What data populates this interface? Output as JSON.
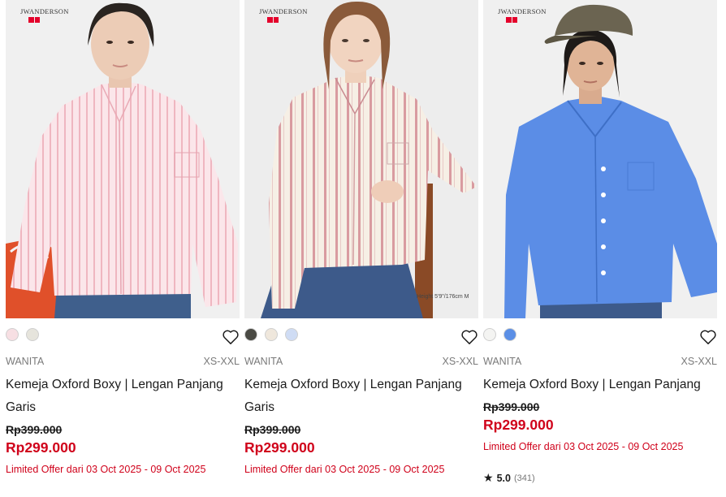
{
  "products": [
    {
      "brand": "JWANDERSON",
      "swatches": [
        "#f7dfe3",
        "#e6e4dc"
      ],
      "gender": "WANITA",
      "sizes": "XS-XXL",
      "name": "Kemeja Oxford Boxy | Lengan Panjang Garis",
      "old_price": "Rp399.000",
      "price": "Rp299.000",
      "offer": "Limited Offer dari 03 Oct 2025 - 09 Oct 2025",
      "heart_icon": "heart-outline-icon"
    },
    {
      "brand": "JWANDERSON",
      "model_info": "Height 5'9\"/176cm M",
      "swatches": [
        "#4a4a44",
        "#efe7dc",
        "#cfdcf4"
      ],
      "gender": "WANITA",
      "sizes": "XS-XXL",
      "name": "Kemeja Oxford Boxy | Lengan Panjang Garis",
      "old_price": "Rp399.000",
      "price": "Rp299.000",
      "offer": "Limited Offer dari 03 Oct 2025 - 09 Oct 2025",
      "heart_icon": "heart-outline-icon"
    },
    {
      "brand": "JWANDERSON",
      "swatches": [
        "#f4f4f2",
        "#5b8fe6"
      ],
      "gender": "WANITA",
      "sizes": "XS-XXL",
      "name": "Kemeja Oxford Boxy | Lengan Panjang",
      "old_price": "Rp399.000",
      "price": "Rp299.000",
      "offer": "Limited Offer dari 03 Oct 2025 - 09 Oct 2025",
      "rating": {
        "score": "5.0",
        "count": "(341)",
        "icon": "star-icon"
      },
      "heart_icon": "heart-outline-icon"
    }
  ],
  "colors": {
    "sale_red": "#d0021b",
    "uniqlo_red": "#e4002b"
  }
}
